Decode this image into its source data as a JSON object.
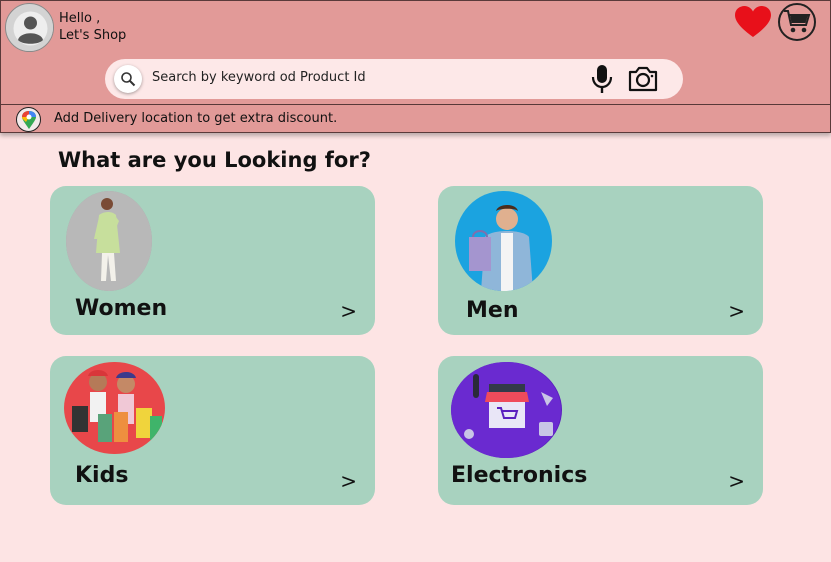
{
  "header": {
    "greeting_line1": "Hello ,",
    "greeting_line2": "Let's Shop"
  },
  "icons": {
    "avatar": "user-avatar-icon",
    "favorites": "heart-icon",
    "cart": "shopping-cart-icon",
    "search": "search-icon",
    "voice": "microphone-icon",
    "camera": "camera-icon",
    "location": "map-pin-icon"
  },
  "search": {
    "placeholder": "Search by keyword od Product Id"
  },
  "location": {
    "text": "Add Delivery location to get extra discount."
  },
  "main": {
    "title": "What are you Looking for?",
    "categories": [
      {
        "label": "Women",
        "arrow": ">"
      },
      {
        "label": "Men",
        "arrow": ">"
      },
      {
        "label": "Kids",
        "arrow": ">"
      },
      {
        "label": "Electronics",
        "arrow": ">"
      }
    ]
  },
  "colors": {
    "background": "#fde4e4",
    "header": "#e29a98",
    "card": "#a8d2bf",
    "heart": "#e8101a"
  }
}
